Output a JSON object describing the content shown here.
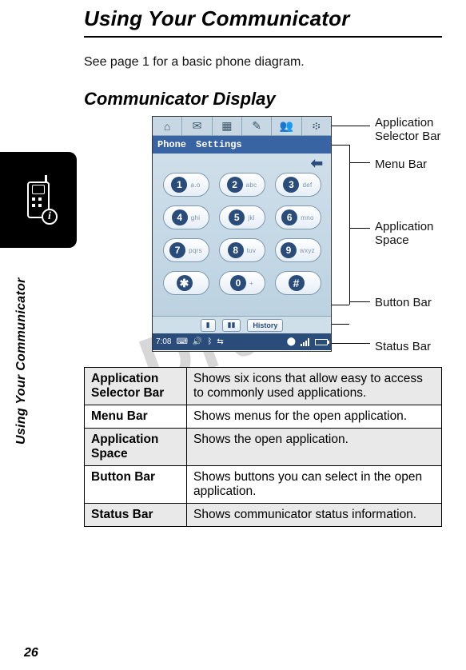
{
  "title": "Using Your Communicator",
  "intro": "See page 1 for a basic phone diagram.",
  "subtitle": "Communicator Display",
  "watermark": "Draft",
  "side_label": "Using Your Communicator",
  "page_number": "26",
  "device": {
    "appsel_icons": [
      "⌂",
      "✉",
      "▦",
      "✎",
      "👥",
      "፨"
    ],
    "menubar": {
      "items": [
        "Phone",
        "Settings"
      ]
    },
    "back_glyph": "⬅",
    "keypad": [
      [
        {
          "digit": "1",
          "sub": "a.o"
        },
        {
          "digit": "2",
          "sub": "abc"
        },
        {
          "digit": "3",
          "sub": "def"
        }
      ],
      [
        {
          "digit": "4",
          "sub": "ghi"
        },
        {
          "digit": "5",
          "sub": "jkl"
        },
        {
          "digit": "6",
          "sub": "mno"
        }
      ],
      [
        {
          "digit": "7",
          "sub": "pqrs"
        },
        {
          "digit": "8",
          "sub": "tuv"
        },
        {
          "digit": "9",
          "sub": "wxyz"
        }
      ],
      [
        {
          "digit": "✱",
          "sub": ""
        },
        {
          "digit": "0",
          "sub": "+"
        },
        {
          "digit": "#",
          "sub": ""
        }
      ]
    ],
    "buttonbar": {
      "contact": "▮",
      "camera": "▮▮",
      "history": "History"
    },
    "statusbar": {
      "time": "7:08"
    }
  },
  "callouts": {
    "appsel": "Application\nSelector Bar",
    "menubar": "Menu Bar",
    "appspace": "Application\nSpace",
    "buttonbar": "Button Bar",
    "statusbar": "Status Bar"
  },
  "definitions": [
    {
      "term": "Application Selector Bar",
      "desc": "Shows six icons that allow easy to access to commonly used applications.",
      "shade": true
    },
    {
      "term": "Menu Bar",
      "desc": "Shows menus for the open application.",
      "shade": false
    },
    {
      "term": "Application Space",
      "desc": "Shows the open application.",
      "shade": true
    },
    {
      "term": "Button Bar",
      "desc": "Shows buttons you can select in the open application.",
      "shade": false
    },
    {
      "term": "Status Bar",
      "desc": "Shows communicator status information.",
      "shade": true
    }
  ]
}
